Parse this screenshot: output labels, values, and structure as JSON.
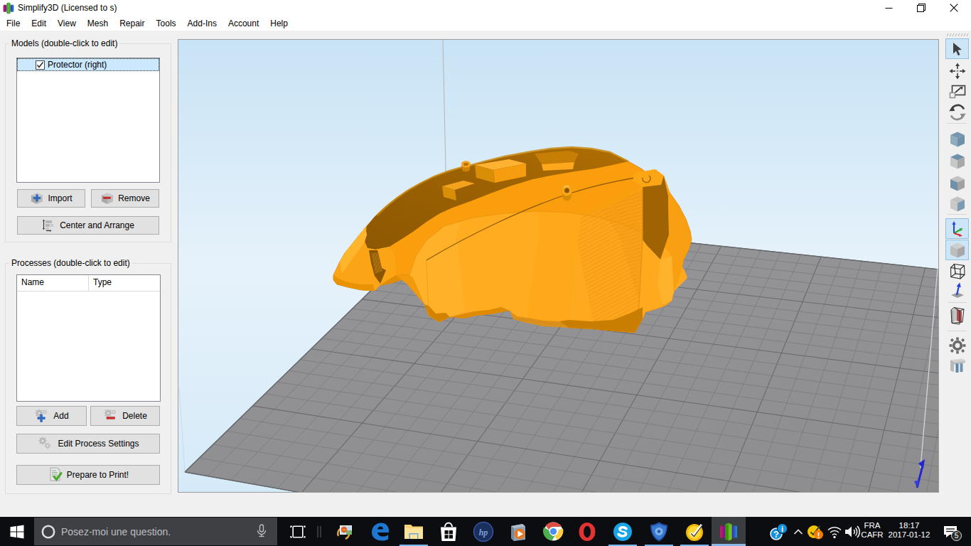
{
  "window": {
    "title": "Simplify3D (Licensed to s)",
    "controls": {
      "minimize": "minimize",
      "restore": "restore-down",
      "close": "close"
    }
  },
  "menu": {
    "items": [
      "File",
      "Edit",
      "View",
      "Mesh",
      "Repair",
      "Tools",
      "Add-Ins",
      "Account",
      "Help"
    ]
  },
  "models_panel": {
    "group_label": "Models (double-click to edit)",
    "list": {
      "items": [
        {
          "label": "Protector (right)",
          "checked": true,
          "selected": true
        }
      ]
    },
    "buttons": {
      "import": "Import",
      "remove": "Remove",
      "center_arrange": "Center and Arrange"
    }
  },
  "processes_panel": {
    "group_label": "Processes (double-click to edit)",
    "table": {
      "columns": {
        "name": "Name",
        "type": "Type"
      },
      "rows": []
    },
    "buttons": {
      "add": "Add",
      "delete": "Delete",
      "edit_settings": "Edit Process Settings",
      "prepare": "Prepare to Print!"
    }
  },
  "viewport": {
    "model_name": "Protector (right)",
    "scene": "orange faceted protector shell model resting on gray perspective build plate grid under light blue sky"
  },
  "toolbar": {
    "buttons": [
      {
        "name": "select-tool",
        "active": true
      },
      {
        "name": "translate-tool",
        "active": false
      },
      {
        "name": "scale-tool",
        "active": false
      },
      {
        "name": "rotate-tool",
        "active": false
      },
      {
        "name": "default-view",
        "active": false
      },
      {
        "name": "top-view",
        "active": false
      },
      {
        "name": "front-view",
        "active": false
      },
      {
        "name": "side-view",
        "active": false
      },
      {
        "name": "toggle-axes",
        "active": true
      },
      {
        "name": "toggle-build-table",
        "active": true
      },
      {
        "name": "wireframe-view",
        "active": false
      },
      {
        "name": "surface-normals",
        "active": false
      },
      {
        "name": "cross-section",
        "active": false
      },
      {
        "name": "preferences",
        "active": false
      },
      {
        "name": "machine-control-panel",
        "active": false
      }
    ]
  },
  "taskbar": {
    "search": {
      "placeholder": "Posez-moi une question."
    },
    "apps": [
      {
        "name": "task-view",
        "active": false
      },
      {
        "name": "photos",
        "active": false
      },
      {
        "name": "edge",
        "active": false
      },
      {
        "name": "file-explorer",
        "active": true
      },
      {
        "name": "store",
        "active": false
      },
      {
        "name": "hp",
        "active": false
      },
      {
        "name": "media-player",
        "active": false
      },
      {
        "name": "chrome",
        "active": false
      },
      {
        "name": "opera",
        "active": false
      },
      {
        "name": "skype",
        "active": true
      },
      {
        "name": "security-shield",
        "active": true
      },
      {
        "name": "norton",
        "active": true
      },
      {
        "name": "simplify3d",
        "active": true,
        "focused": true
      }
    ],
    "tray": {
      "language": {
        "line1": "FRA",
        "line2": "CAFR"
      },
      "clock": {
        "time": "18:17",
        "date": "2017-01-12"
      },
      "notification_badge": "5"
    }
  },
  "colors": {
    "selection_fill": "#cce8ff",
    "model_orange": "#ffa318",
    "model_dark_rim": "#965e02",
    "plate_gray": "#8f8f90",
    "sky_top": "#c8e3f5",
    "sky_mid": "#e6f2fb",
    "sky_bottom": "#d5eaf8",
    "taskbar_underline": "#76b9ed",
    "active_tool_bg": "#cde6f7"
  }
}
